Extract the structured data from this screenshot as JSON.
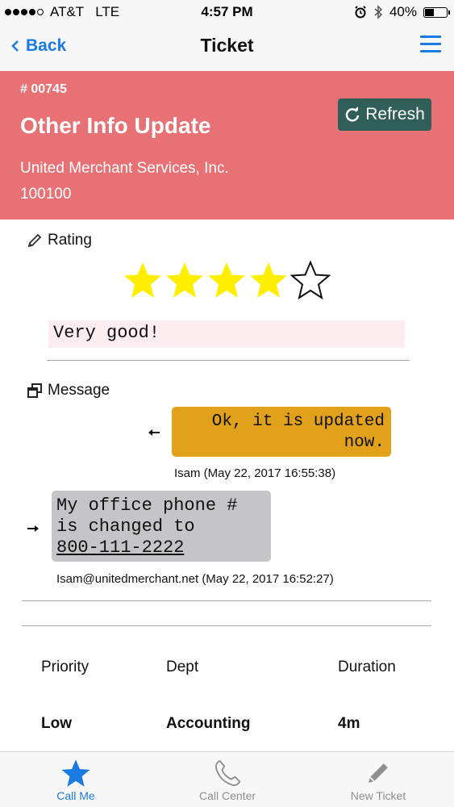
{
  "status_bar": {
    "carrier": "AT&T",
    "network": "LTE",
    "time": "4:57 PM",
    "battery": "40%"
  },
  "nav": {
    "back_label": "Back",
    "title": "Ticket"
  },
  "ticket": {
    "number": "# 00745",
    "title": "Other Info Update",
    "company": "United Merchant Services, Inc.",
    "company_id": "100100",
    "refresh_label": "Refresh"
  },
  "rating": {
    "label": "Rating",
    "stars_filled": 4,
    "stars_total": 5,
    "comment": "Very good!"
  },
  "messages": {
    "label": "Message",
    "items": [
      {
        "direction": "outgoing",
        "text": "Ok, it is updated now.",
        "meta": "Isam (May 22, 2017 16:55:38)"
      },
      {
        "direction": "incoming",
        "text_line1": "My office phone #",
        "text_line2": "is changed to",
        "phone": "800-111-2222",
        "meta": "Isam@unitedmerchant.net (May 22, 2017 16:52:27)"
      }
    ]
  },
  "info": {
    "priority_label": "Priority",
    "priority_value": "Low",
    "dept_label": "Dept",
    "dept_value": "Accounting",
    "duration_label": "Duration",
    "duration_value": "4m"
  },
  "tabbar": {
    "items": [
      {
        "label": "Call Me",
        "icon": "star-icon",
        "active": true
      },
      {
        "label": "Call Center",
        "icon": "phone-icon",
        "active": false
      },
      {
        "label": "New Ticket",
        "icon": "pencil-icon",
        "active": false
      }
    ]
  },
  "colors": {
    "header": "#e77174",
    "refresh_button": "#2f5f58",
    "accent": "#1a7be3",
    "outgoing_bubble": "#e1a11a",
    "incoming_bubble": "#c5c5c7",
    "star_fill": "#ffee00"
  }
}
